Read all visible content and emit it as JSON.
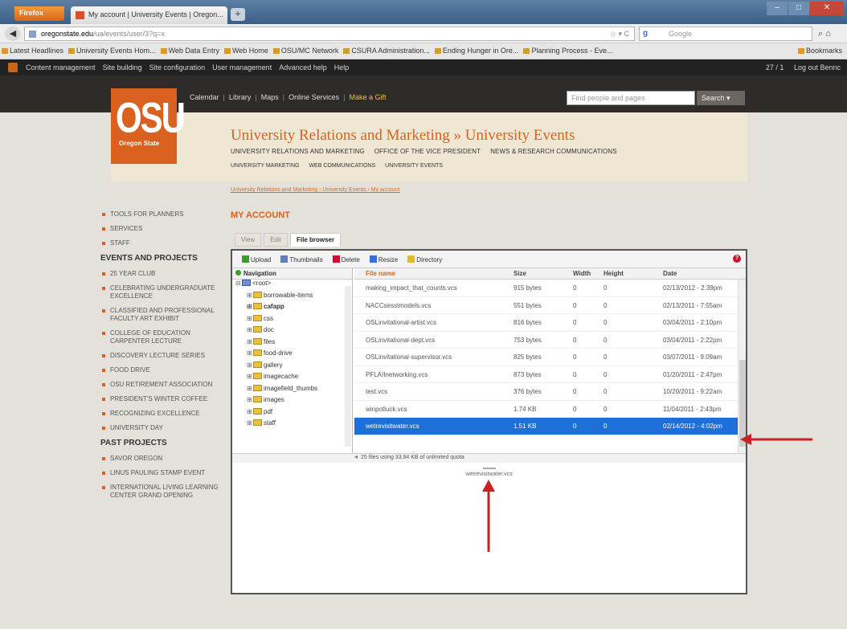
{
  "browser": {
    "app_button": "Firefox",
    "tab_title": "My account | University Events | Oregon...",
    "new_tab": "+",
    "url_site": "oregonstate.edu",
    "url_path": "/ua/events/user/3?q=x",
    "url_right": "☆ ▾ C",
    "search_engine": "Google",
    "search_placeholder": "Google",
    "bookmarks": [
      "Latest Headlines",
      "University Events Hom...",
      "Web Data Entry",
      "Web Home",
      "OSU/MC Network",
      "CSURA Administration...",
      "Ending Hunger in Ore...",
      "Planning Process - Eve..."
    ],
    "bookmarks_right": "Bookmarks"
  },
  "adminbar": {
    "items": [
      "Content management",
      "Site building",
      "Site configuration",
      "User management",
      "Advanced help",
      "Help"
    ],
    "count": "27 / 1",
    "logout": "Log out Bennc"
  },
  "header": {
    "logo_big": "OSU",
    "logo_small": "Oregon State",
    "links": [
      "Calendar",
      "Library",
      "Maps",
      "Online Services",
      "Make a Gift"
    ],
    "search_placeholder": "Find people and pages",
    "search_button": "Search ▾",
    "site_name": "University Relations and Marketing » University Events",
    "sub_links1": [
      "UNIVERSITY RELATIONS AND MARKETING",
      "OFFICE OF THE VICE PRESIDENT",
      "NEWS & RESEARCH COMMUNICATIONS"
    ],
    "sub_links2": [
      "UNIVERSITY MARKETING",
      "WEB COMMUNICATIONS",
      "UNIVERSITY EVENTS"
    ],
    "breadcrumb": "University Relations and Marketing › University Events › My account"
  },
  "sidebar": {
    "top_items": [
      "TOOLS FOR PLANNERS",
      "SERVICES",
      "STAFF"
    ],
    "events_heading": "EVENTS AND PROJECTS",
    "event_items": [
      "25 YEAR CLUB",
      "CELEBRATING UNDERGRADUATE EXCELLENCE",
      "CLASSIFIED AND PROFESSIONAL FACULTY ART EXHIBIT",
      "COLLEGE OF EDUCATION CARPENTER LECTURE",
      "DISCOVERY LECTURE SERIES",
      "FOOD DRIVE",
      "OSU RETIREMENT ASSOCIATION",
      "PRESIDENT'S WINTER COFFEE",
      "RECOGNIZING EXCELLENCE",
      "UNIVERSITY DAY"
    ],
    "past_heading": "PAST PROJECTS",
    "past_items": [
      "SAVOR OREGON",
      "LINUS PAULING STAMP EVENT",
      "INTERNATIONAL LIVING LEARNING CENTER GRAND OPENING"
    ]
  },
  "main": {
    "title": "MY ACCOUNT",
    "tabs": [
      "View",
      "Edit",
      "File browser"
    ],
    "toolbar": [
      "Upload",
      "Thumbnails",
      "Delete",
      "Resize",
      "Directory"
    ],
    "nav_header": "Navigation",
    "tree": [
      {
        "label": "<root>",
        "exp": "⊟",
        "root": true,
        "indent": 0
      },
      {
        "label": "borrowable-items",
        "exp": "⊞",
        "indent": 1
      },
      {
        "label": "cafapp",
        "exp": "⊞",
        "indent": 1,
        "bold": true
      },
      {
        "label": "css",
        "exp": "⊞",
        "indent": 1
      },
      {
        "label": "doc",
        "exp": "⊞",
        "indent": 1
      },
      {
        "label": "files",
        "exp": "⊞",
        "indent": 1
      },
      {
        "label": "food-drive",
        "exp": "⊞",
        "indent": 1
      },
      {
        "label": "gallery",
        "exp": "⊞",
        "indent": 1
      },
      {
        "label": "imagecache",
        "exp": "⊞",
        "indent": 1
      },
      {
        "label": "imagefield_thumbs",
        "exp": "⊞",
        "indent": 1
      },
      {
        "label": "images",
        "exp": "⊞",
        "indent": 1
      },
      {
        "label": "pdf",
        "exp": "⊞",
        "indent": 1
      },
      {
        "label": "staff",
        "exp": "⊞",
        "indent": 1
      }
    ],
    "columns": {
      "name": "File name",
      "size": "Size",
      "width": "Width",
      "height": "Height",
      "date": "Date"
    },
    "files": [
      {
        "name": "making_impact_that_counts.vcs",
        "size": "915 bytes",
        "w": "0",
        "h": "0",
        "date": "02/13/2012 - 2:39pm"
      },
      {
        "name": "NACCsesstmodels.vcs",
        "size": "551 bytes",
        "w": "0",
        "h": "0",
        "date": "02/13/2011 - 7:55am"
      },
      {
        "name": "OSLinvitational-artist.vcs",
        "size": "816 bytes",
        "w": "0",
        "h": "0",
        "date": "03/04/2011 - 2:10pm"
      },
      {
        "name": "OSLinvitational-dept.vcs",
        "size": "753 bytes",
        "w": "0",
        "h": "0",
        "date": "03/04/2011 - 2:22pm"
      },
      {
        "name": "OSLinvitational-supervisor.vcs",
        "size": "825 bytes",
        "w": "0",
        "h": "0",
        "date": "03/07/2011 - 9:09am"
      },
      {
        "name": "PFLAIInetworking.vcs",
        "size": "873 bytes",
        "w": "0",
        "h": "0",
        "date": "01/20/2011 - 2:47pm"
      },
      {
        "name": "test.vcs",
        "size": "376 bytes",
        "w": "0",
        "h": "0",
        "date": "10/20/2011 - 9:22am"
      },
      {
        "name": "winpotluck.vcs",
        "size": "1.74 KB",
        "w": "0",
        "h": "0",
        "date": "11/04/2011 - 2:43pm"
      },
      {
        "name": "wetrevisitwater.vcs",
        "size": "1.51 KB",
        "w": "0",
        "h": "0",
        "date": "02/14/2012 - 4:02pm",
        "selected": true
      }
    ],
    "status": "25 files using 33.94 KB of unlimited quota",
    "preview_name": "wetrevisitwater.vcs"
  },
  "annotation_color": "#cc1f25"
}
